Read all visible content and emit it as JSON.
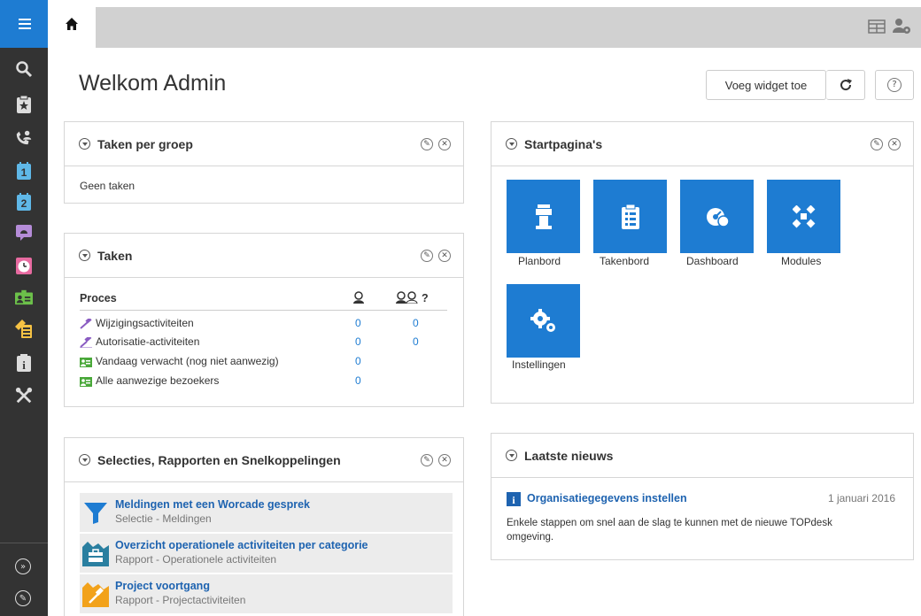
{
  "header": {
    "title": "Welkom Admin",
    "add_widget_label": "Voeg widget toe",
    "refresh_symbol": "⟳",
    "help_symbol": "?"
  },
  "sidebar": {
    "icons": [
      "menu-icon",
      "search-icon",
      "clipboard-star-icon",
      "phone-user-icon",
      "calendar-1-icon",
      "calendar-2-icon",
      "speech-bubble-icon",
      "clock-icon",
      "visitor-badge-icon",
      "asset-tag-icon",
      "info-icon",
      "tools-icon",
      "expand-icon",
      "edit-icon"
    ]
  },
  "widgets": {
    "taken_per_groep": {
      "title": "Taken per groep",
      "empty_text": "Geen taken"
    },
    "taken": {
      "title": "Taken",
      "col_process": "Proces",
      "col_unassigned_symbol": "?",
      "rows": [
        {
          "label": "Wijzigingsactiviteiten",
          "c1": "0",
          "c2": "0",
          "icon": "hammer-icon"
        },
        {
          "label": "Autorisatie-activiteiten",
          "c1": "0",
          "c2": "0",
          "icon": "gavel-icon"
        },
        {
          "label": "Vandaag verwacht (nog niet aanwezig)",
          "c1": "0",
          "c2": "",
          "icon": "visitor-icon"
        },
        {
          "label": "Alle aanwezige bezoekers",
          "c1": "0",
          "c2": "",
          "icon": "visitor-icon"
        }
      ]
    },
    "startpaginas": {
      "title": "Startpagina's",
      "tiles": [
        {
          "label": "Planbord",
          "icon": "tower-icon"
        },
        {
          "label": "Takenbord",
          "icon": "clipboard-icon"
        },
        {
          "label": "Dashboard",
          "icon": "gauge-icon"
        },
        {
          "label": "Modules",
          "icon": "modules-icon"
        },
        {
          "label": "Instellingen",
          "icon": "gears-icon"
        }
      ]
    },
    "selecties": {
      "title": "Selecties, Rapporten en Snelkoppelingen",
      "items": [
        {
          "title": "Meldingen met een Worcade gesprek",
          "subtitle": "Selectie - Meldingen",
          "icon": "filter-icon"
        },
        {
          "title": "Overzicht operationele activiteiten per categorie",
          "subtitle": "Rapport - Operationele activiteiten",
          "icon": "chart-toolbox-icon"
        },
        {
          "title": "Project voortgang",
          "subtitle": "Rapport - Projectactiviteiten",
          "icon": "chart-hammer-icon"
        }
      ]
    },
    "nieuws": {
      "title": "Laatste nieuws",
      "item_title": "Organisatiegegevens instellen",
      "item_date": "1 januari 2016",
      "item_text": "Enkele stappen om snel aan de slag te kunnen met de nieuwe TOPdesk omgeving."
    }
  },
  "colors": {
    "accent": "#1e7cd2",
    "sidebar": "#333333",
    "link": "#1e63b0"
  }
}
